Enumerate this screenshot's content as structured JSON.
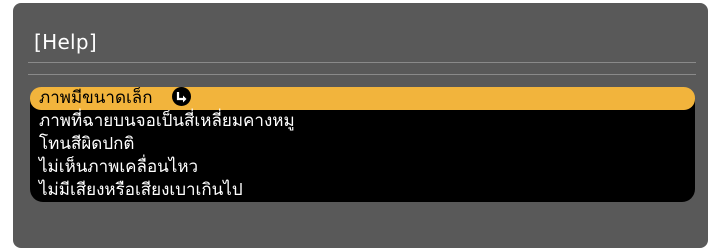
{
  "window": {
    "title": "[Help]"
  },
  "menu": {
    "items": [
      {
        "label": "ภาพมีขนาดเล็ก",
        "selected": true
      },
      {
        "label": "ภาพที่ฉายบนจอเป็นสี่เหลี่ยมคางหมู",
        "selected": false
      },
      {
        "label": "โทนสีผิดปกติ",
        "selected": false
      },
      {
        "label": "ไม่เห็นภาพเคลื่อนไหว",
        "selected": false
      },
      {
        "label": "ไม่มีเสียงหรือเสียงเบาเกินไป",
        "selected": false
      }
    ]
  },
  "icons": {
    "selected_item_icon": "enter-icon"
  },
  "colors": {
    "panel_bg": "#595959",
    "list_bg": "#000000",
    "highlight": "#f2b43c",
    "text": "#ffffff"
  }
}
